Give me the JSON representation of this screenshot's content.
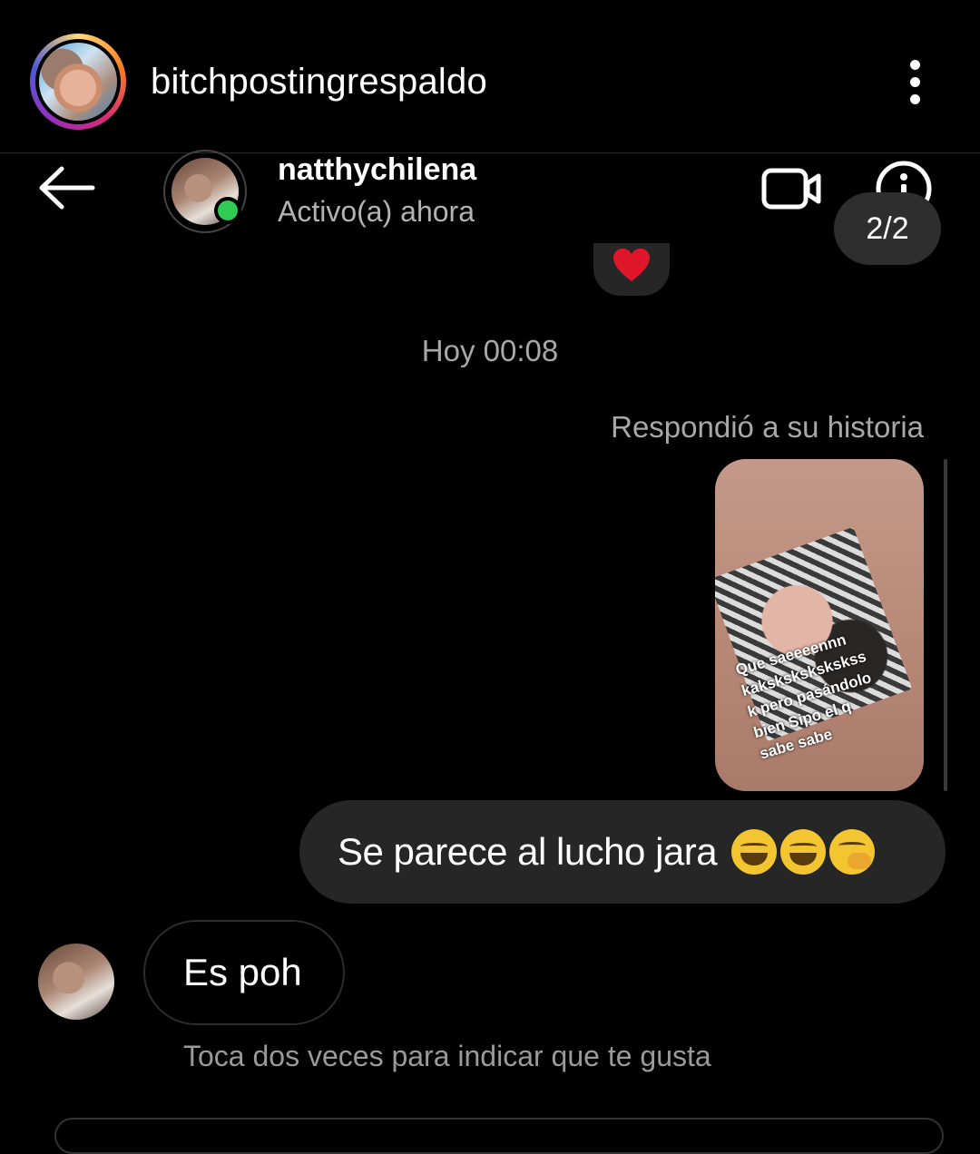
{
  "post": {
    "username": "bitchpostingrespaldo"
  },
  "chat": {
    "name": "natthychilena",
    "status": "Activo(a) ahora",
    "page_indicator": "2/2"
  },
  "conversation": {
    "timestamp": "Hoy 00:08",
    "reply_label": "Respondió a su historia",
    "story_caption": "Que saeeeennn\nkakskskskskskss\nk pero pasándolo\nbien Sipo el q\nsabe sabe",
    "outgoing_message": "Se parece al lucho jara",
    "incoming_message": "Es poh",
    "hint": "Toca dos veces para indicar que te gusta"
  },
  "icons": {
    "more": "more-vertical-icon",
    "back": "arrow-left-icon",
    "video": "video-call-icon",
    "info": "info-icon",
    "reaction": "heart-icon",
    "emojis": [
      "grinning-sweat-emoji",
      "grinning-sweat-emoji",
      "hand-over-mouth-emoji"
    ]
  },
  "colors": {
    "background": "#000000",
    "bubble": "#262626",
    "online": "#2fcb52",
    "heart": "#e0162b",
    "muted_text": "#a8a8a8"
  }
}
